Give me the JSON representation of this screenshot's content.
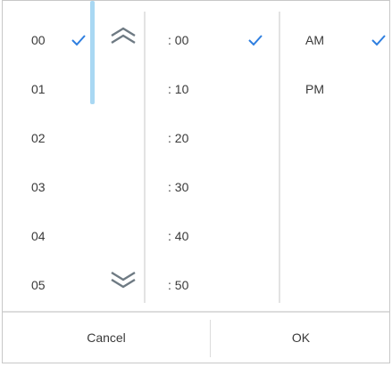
{
  "hours": {
    "items": [
      "00",
      "01",
      "02",
      "03",
      "04",
      "05"
    ],
    "selected": "00"
  },
  "minutes": {
    "items": [
      ": 00",
      ": 10",
      ": 20",
      ": 30",
      ": 40",
      ": 50"
    ],
    "selected": ": 00"
  },
  "period": {
    "items": [
      "AM",
      "PM"
    ],
    "selected": "AM"
  },
  "footer": {
    "cancel_label": "Cancel",
    "ok_label": "OK"
  },
  "colors": {
    "check": "#2f7fe0",
    "scroll_indicator": "#a9d8f3",
    "chevron": "#6e7a83"
  },
  "icons": [
    "checkmark-icon",
    "chevron-up-double-icon",
    "chevron-down-double-icon"
  ]
}
